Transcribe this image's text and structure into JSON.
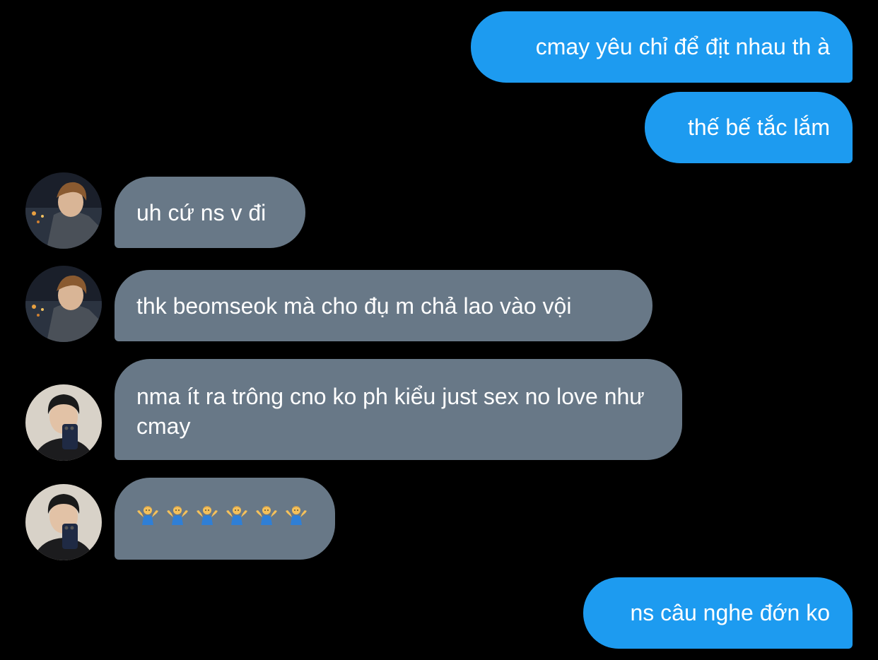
{
  "messages": [
    {
      "side": "sent",
      "text": "cmay yêu chỉ để địt nhau th à"
    },
    {
      "side": "sent",
      "text": "thế bế tắc lắm"
    },
    {
      "side": "received",
      "avatar": "user-a-avatar",
      "text": "uh cứ ns v đi"
    },
    {
      "side": "received",
      "avatar": "user-a-avatar",
      "text": "thk beomseok mà cho đụ m chả lao vào vội"
    },
    {
      "side": "received",
      "avatar": "user-b-avatar",
      "text": "nma ít ra trông cno ko ph kiểu just sex no love như cmay"
    },
    {
      "side": "received",
      "avatar": "user-b-avatar",
      "emoji": "shrug-icon",
      "emoji_count": 6
    },
    {
      "side": "sent",
      "text": "ns câu nghe đớn ko"
    }
  ],
  "colors": {
    "background": "#000000",
    "sent_bubble": "#1d9bf0",
    "received_bubble": "#687887",
    "text": "#ffffff"
  }
}
